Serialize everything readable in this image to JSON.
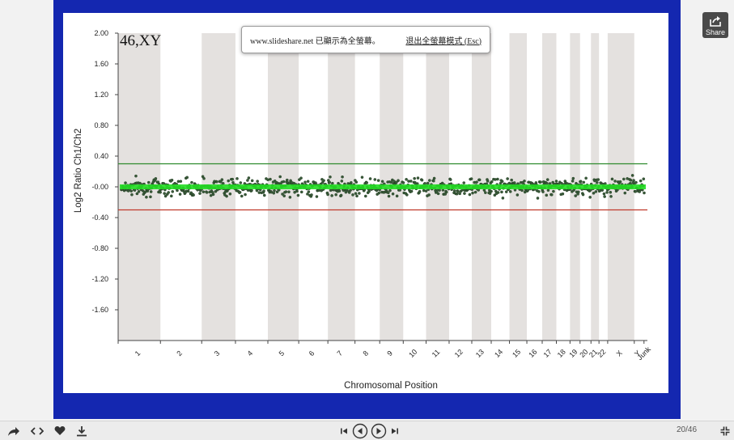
{
  "banner": {
    "message": "www.slideshare.net 已顯示為全螢幕。",
    "exit_label": "退出全螢幕模式 (Esc)"
  },
  "share": {
    "label": "Share"
  },
  "pager": {
    "counter": "20/46"
  },
  "icons": {
    "share": "share-arrow-icon",
    "embed": "code-brackets-icon",
    "like": "heart-icon",
    "download": "download-icon",
    "first": "skip-first-icon",
    "prev": "previous-circle-icon",
    "next": "next-circle-icon",
    "last": "skip-last-icon",
    "fullscreen_exit": "exit-fullscreen-icon"
  },
  "colors": {
    "frame": "#1427b0",
    "band": "#e4e1df",
    "upper_threshold": "#2e8b2e",
    "lower_threshold": "#c0392b",
    "trend": "#22dd22",
    "points": "#3a5a3a"
  },
  "chart_data": {
    "type": "scatter",
    "annotation": "46,XY",
    "xlabel": "Chromosomal Position",
    "ylabel": "Log2 Ratio Ch1/Ch2",
    "ylim": [
      -2.0,
      2.0
    ],
    "y_ticks": [
      "2.00",
      "1.60",
      "1.20",
      "0.80",
      "0.40",
      "-0.00",
      "-0.40",
      "-0.80",
      "-1.20",
      "-1.60"
    ],
    "y_tick_values": [
      2.0,
      1.6,
      1.2,
      0.8,
      0.4,
      0.0,
      -0.4,
      -0.8,
      -1.2,
      -1.6
    ],
    "upper_threshold": 0.3,
    "lower_threshold": -0.3,
    "trend_value": 0.0,
    "chromosomes": [
      "1",
      "2",
      "3",
      "4",
      "5",
      "6",
      "7",
      "8",
      "9",
      "10",
      "11",
      "12",
      "13",
      "14",
      "15",
      "16",
      "17",
      "18",
      "19",
      "20",
      "21",
      "22",
      "X",
      "Y",
      "Junk"
    ],
    "chromosome_relative_size": [
      248,
      242,
      198,
      190,
      181,
      171,
      159,
      145,
      138,
      134,
      135,
      133,
      114,
      107,
      102,
      90,
      83,
      80,
      59,
      64,
      47,
      51,
      156,
      57,
      20
    ],
    "shaded_chromosomes": [
      "1",
      "3",
      "5",
      "7",
      "9",
      "11",
      "13",
      "15",
      "17",
      "19",
      "21",
      "X"
    ],
    "noise_amplitude": 0.08
  }
}
